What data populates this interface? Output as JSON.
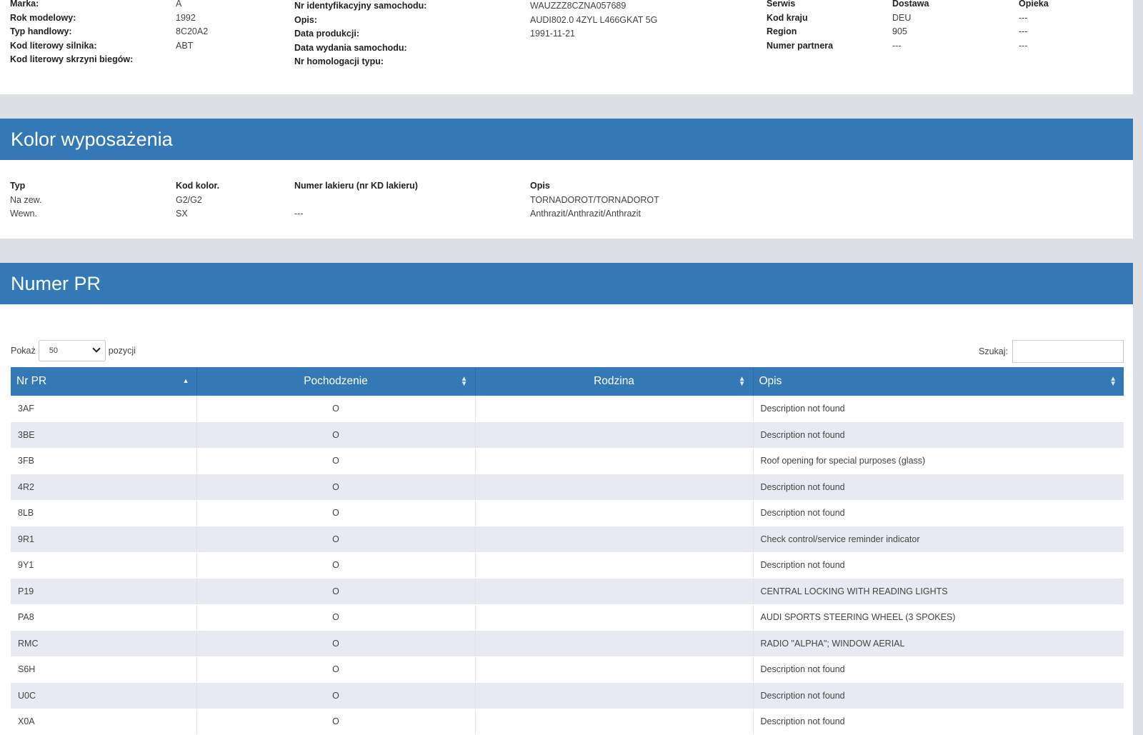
{
  "vehicle": {
    "col1_labels": [
      "Marka:",
      "Rok modelowy:",
      "Typ handlowy:",
      "Kod literowy silnika:",
      "Kod literowy skrzyni biegów:"
    ],
    "col1_values": [
      "A",
      "1992",
      "8C20A2",
      "ABT",
      ""
    ],
    "col2_labels": [
      "Nr identyfikacyjny samochodu:",
      "Opis:",
      "Data produkcji:",
      "Data wydania samochodu:",
      "Nr homologacji typu:"
    ],
    "col2_values": [
      "WAUZZZ8CZNA057689",
      "AUDI802.0 4ZYL L466GKAT 5G",
      "1991-11-21",
      "",
      ""
    ],
    "col3_labels": [
      "Serwis",
      "Kod kraju",
      "Region",
      "Numer partnera"
    ],
    "col4_values": [
      "Dostawa",
      "DEU",
      "905",
      "---"
    ],
    "col5_values": [
      "Opieka",
      "---",
      "---",
      "---"
    ]
  },
  "color_section": {
    "title": "Kolor wyposażenia",
    "headers": [
      "Typ",
      "Kod kolor.",
      "Numer lakieru (nr KD lakieru)",
      "Opis"
    ],
    "rows": [
      [
        "Na zew.",
        "G2/G2",
        "",
        "TORNADOROT/TORNADOROT"
      ],
      [
        "Wewn.",
        "SX",
        "---",
        "Anthrazit/Anthrazit/Anthrazit"
      ]
    ]
  },
  "pr_section": {
    "title": "Numer PR",
    "show_label": "Pokaż",
    "show_value": "50",
    "entries_label": "pozycji",
    "search_label": "Szukaj:",
    "search_value": "",
    "columns": [
      "Nr PR",
      "Pochodzenie",
      "Rodzina",
      "Opis"
    ],
    "rows": [
      [
        "3AF",
        "O",
        "",
        "Description not found"
      ],
      [
        "3BE",
        "O",
        "",
        "Description not found"
      ],
      [
        "3FB",
        "O",
        "",
        "Roof opening for special purposes (glass)"
      ],
      [
        "4R2",
        "O",
        "",
        "Description not found"
      ],
      [
        "8LB",
        "O",
        "",
        "Description not found"
      ],
      [
        "9R1",
        "O",
        "",
        "Check control/service reminder indicator"
      ],
      [
        "9Y1",
        "O",
        "",
        "Description not found"
      ],
      [
        "P19",
        "O",
        "",
        "CENTRAL LOCKING WITH READING LIGHTS"
      ],
      [
        "PA8",
        "O",
        "",
        "AUDI SPORTS STEERING WHEEL (3 SPOKES)"
      ],
      [
        "RMC",
        "O",
        "",
        "RADIO \"ALPHA\"; WINDOW AERIAL"
      ],
      [
        "S6H",
        "O",
        "",
        "Description not found"
      ],
      [
        "U0C",
        "O",
        "",
        "Description not found"
      ],
      [
        "X0A",
        "O",
        "",
        "Description not found"
      ]
    ]
  },
  "colors": {
    "header_blue": "#3479b6",
    "stripe": "#e8eaf3",
    "background": "#dcdfe3"
  }
}
